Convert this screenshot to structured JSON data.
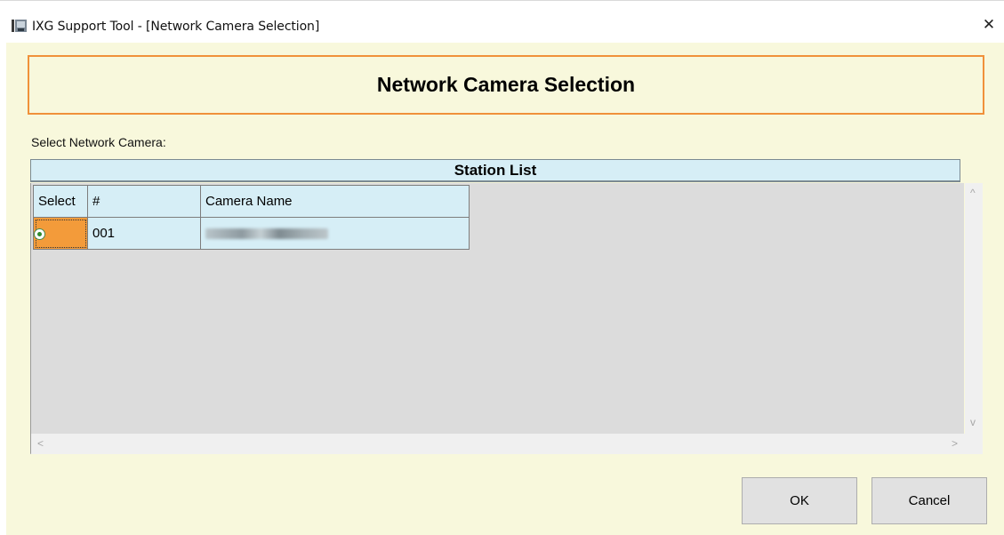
{
  "window": {
    "title": "IXG Support Tool - [Network Camera Selection]",
    "close_glyph": "✕"
  },
  "header": {
    "title": "Network Camera Selection"
  },
  "select_label": "Select Network Camera:",
  "station_list": {
    "title": "Station List",
    "columns": [
      "Select",
      "#",
      "Camera Name"
    ],
    "rows": [
      {
        "selected": true,
        "number": "001",
        "camera_name": ""
      }
    ]
  },
  "scrollbar": {
    "up": "^",
    "down": "v",
    "left": "<",
    "right": ">"
  },
  "buttons": {
    "ok": "OK",
    "cancel": "Cancel"
  },
  "colors": {
    "accent_orange": "#f0913a",
    "client_background": "#f8f8dc",
    "grid_header_blue": "#d6eef6",
    "selected_cell": "#f39b3a"
  }
}
